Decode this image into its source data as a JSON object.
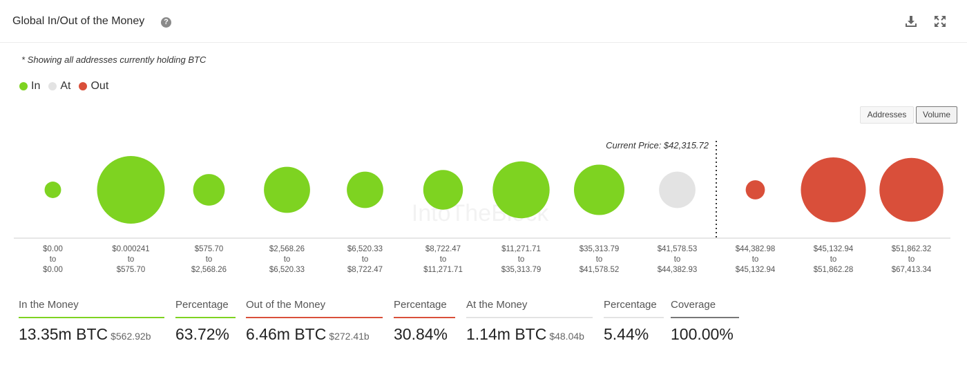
{
  "header": {
    "title": "Global In/Out of the Money",
    "help_glyph": "?",
    "icons": [
      "help-icon",
      "download-icon",
      "expand-icon"
    ]
  },
  "note": "* Showing all addresses currently holding BTC",
  "legend": [
    {
      "label": "In",
      "color": "#7ed321"
    },
    {
      "label": "At",
      "color": "#e3e3e3"
    },
    {
      "label": "Out",
      "color": "#d94f3a"
    }
  ],
  "toggles": {
    "addresses": "Addresses",
    "volume": "Volume",
    "active": "Volume"
  },
  "chart_data": {
    "type": "bubble",
    "current_price_label": "Current Price: $42,315.72",
    "current_price_between": [
      8,
      9
    ],
    "colors": {
      "In": "#7ed321",
      "At": "#e3e3e3",
      "Out": "#d94f3a"
    },
    "series": [
      {
        "from": "$0.00",
        "to": "$0.00",
        "status": "In",
        "relative_volume": 0.05
      },
      {
        "from": "$0.000241",
        "to": "$575.70",
        "status": "In",
        "relative_volume": 1.0
      },
      {
        "from": "$575.70",
        "to": "$2,568.26",
        "status": "In",
        "relative_volume": 0.33
      },
      {
        "from": "$2,568.26",
        "to": "$6,520.33",
        "status": "In",
        "relative_volume": 0.6
      },
      {
        "from": "$6,520.33",
        "to": "$8,722.47",
        "status": "In",
        "relative_volume": 0.42
      },
      {
        "from": "$8,722.47",
        "to": "$11,271.71",
        "status": "In",
        "relative_volume": 0.48
      },
      {
        "from": "$11,271.71",
        "to": "$35,313.79",
        "status": "In",
        "relative_volume": 0.8
      },
      {
        "from": "$35,313.79",
        "to": "$41,578.52",
        "status": "In",
        "relative_volume": 0.68
      },
      {
        "from": "$41,578.53",
        "to": "$44,382.93",
        "status": "At",
        "relative_volume": 0.42
      },
      {
        "from": "$44,382.98",
        "to": "$45,132.94",
        "status": "Out",
        "relative_volume": 0.1
      },
      {
        "from": "$45,132.94",
        "to": "$51,862.28",
        "status": "Out",
        "relative_volume": 0.95
      },
      {
        "from": "$51,862.32",
        "to": "$67,413.34",
        "status": "Out",
        "relative_volume": 0.93
      }
    ],
    "range_connector": "to",
    "watermark": "IntoTheBlock"
  },
  "stats": [
    {
      "label": "In the Money",
      "value": "13.35m BTC",
      "sub": "$562.92b",
      "color": "#7ed321"
    },
    {
      "label": "Percentage",
      "value": "63.72%",
      "sub": "",
      "color": "#7ed321"
    },
    {
      "label": "Out of the Money",
      "value": "6.46m BTC",
      "sub": "$272.41b",
      "color": "#d94f3a"
    },
    {
      "label": "Percentage",
      "value": "30.84%",
      "sub": "",
      "color": "#d94f3a"
    },
    {
      "label": "At the Money",
      "value": "1.14m BTC",
      "sub": "$48.04b",
      "color": "#e3e3e3"
    },
    {
      "label": "Percentage",
      "value": "5.44%",
      "sub": "",
      "color": "#e3e3e3"
    },
    {
      "label": "Coverage",
      "value": "100.00%",
      "sub": "",
      "color": "#777777"
    }
  ]
}
